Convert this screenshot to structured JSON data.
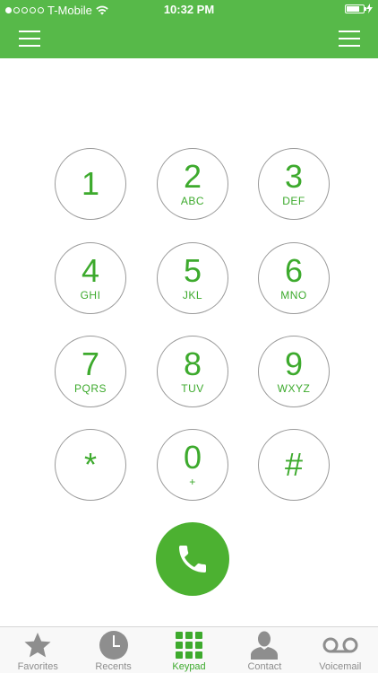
{
  "status_bar": {
    "carrier": "T-Mobile",
    "time": "10:32 PM",
    "signal_bars_filled": 1,
    "signal_bars_total": 5,
    "battery_level": 0.8
  },
  "colors": {
    "brand": "#57b949",
    "accent_text": "#3daa2d",
    "call_button": "#4cb131",
    "tab_inactive": "#8e8e8e"
  },
  "keypad": {
    "keys": [
      {
        "digit": "1",
        "letters": ""
      },
      {
        "digit": "2",
        "letters": "ABC"
      },
      {
        "digit": "3",
        "letters": "DEF"
      },
      {
        "digit": "4",
        "letters": "GHI"
      },
      {
        "digit": "5",
        "letters": "JKL"
      },
      {
        "digit": "6",
        "letters": "MNO"
      },
      {
        "digit": "7",
        "letters": "PQRS"
      },
      {
        "digit": "8",
        "letters": "TUV"
      },
      {
        "digit": "9",
        "letters": "WXYZ"
      },
      {
        "digit": "*",
        "letters": ""
      },
      {
        "digit": "0",
        "letters": "+"
      },
      {
        "digit": "#",
        "letters": ""
      }
    ]
  },
  "tabs": [
    {
      "label": "Favorites",
      "icon": "star-icon",
      "active": false
    },
    {
      "label": "Recents",
      "icon": "clock-icon",
      "active": false
    },
    {
      "label": "Keypad",
      "icon": "keypad-grid-icon",
      "active": true
    },
    {
      "label": "Contact",
      "icon": "person-icon",
      "active": false
    },
    {
      "label": "Voicemail",
      "icon": "voicemail-icon",
      "active": false
    }
  ]
}
